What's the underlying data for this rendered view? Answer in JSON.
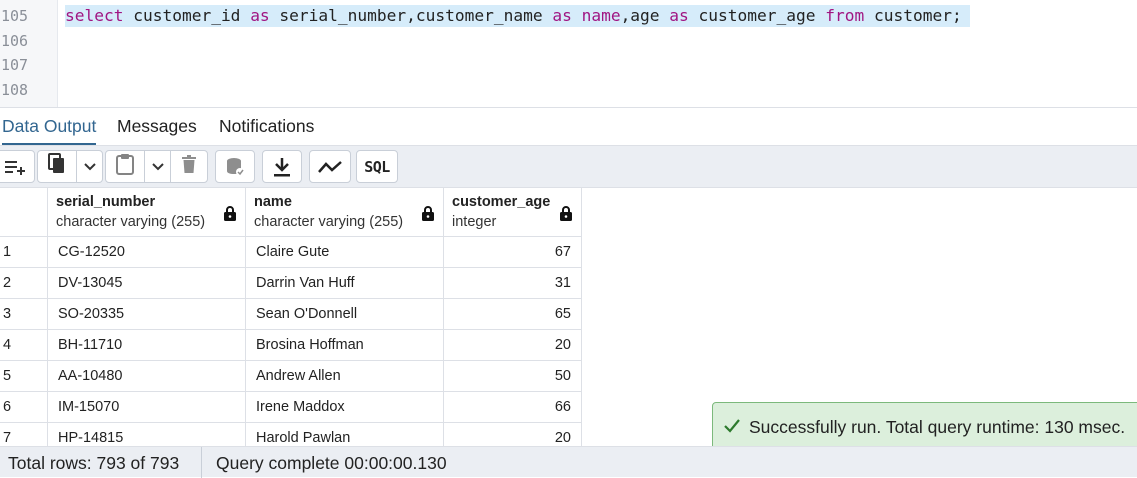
{
  "editor": {
    "line_numbers": [
      "105",
      "106",
      "107",
      "108"
    ],
    "code": {
      "t1": "select",
      "t2": " customer_id ",
      "t3": "as",
      "t4": " serial_number,customer_name ",
      "t5": "as",
      "t6": " ",
      "t7": "name",
      "t8": ",age ",
      "t9": "as",
      "t10": " customer_age ",
      "t11": "from",
      "t12": " customer;"
    }
  },
  "tabs": [
    {
      "label": "Data Output",
      "active": true
    },
    {
      "label": "Messages",
      "active": false
    },
    {
      "label": "Notifications",
      "active": false
    }
  ],
  "toolbar": {
    "icons": [
      "add-row-icon",
      "copy-icon",
      "chevron-down-icon",
      "paste-icon",
      "chevron-down-icon",
      "delete-icon",
      "save-data-icon",
      "download-icon",
      "graph-icon",
      "sql-icon"
    ],
    "sql_label": "SQL"
  },
  "grid": {
    "columns": [
      {
        "name": "serial_number",
        "type": "character varying (255)"
      },
      {
        "name": "name",
        "type": "character varying (255)"
      },
      {
        "name": "customer_age",
        "type": "integer"
      }
    ],
    "rows": [
      {
        "n": "1",
        "serial": "CG-12520",
        "name": "Claire Gute",
        "age": "67"
      },
      {
        "n": "2",
        "serial": "DV-13045",
        "name": "Darrin Van Huff",
        "age": "31"
      },
      {
        "n": "3",
        "serial": "SO-20335",
        "name": "Sean O'Donnell",
        "age": "65"
      },
      {
        "n": "4",
        "serial": "BH-11710",
        "name": "Brosina Hoffman",
        "age": "20"
      },
      {
        "n": "5",
        "serial": "AA-10480",
        "name": "Andrew Allen",
        "age": "50"
      },
      {
        "n": "6",
        "serial": "IM-15070",
        "name": "Irene Maddox",
        "age": "66"
      },
      {
        "n": "7",
        "serial": "HP-14815",
        "name": "Harold Pawlan",
        "age": "20"
      }
    ]
  },
  "status": {
    "total_rows": "Total rows: 793 of 793",
    "query_complete": "Query complete 00:00:00.130"
  },
  "toast": {
    "message": "Successfully run. Total query runtime: 130 msec."
  },
  "colors": {
    "keyword": "#a01582",
    "active_tab": "#326690",
    "selection": "#d6ecfa",
    "toast_bg": "#dcefdc",
    "toast_border": "#7cb97c"
  }
}
